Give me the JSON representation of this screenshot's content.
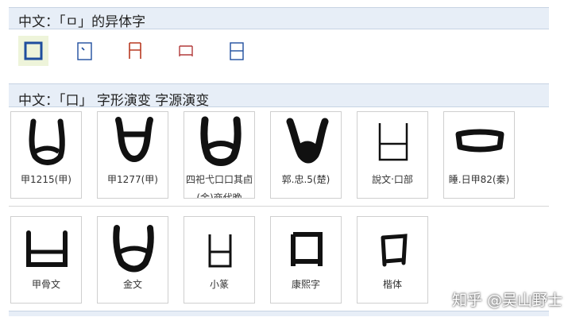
{
  "section1": {
    "title": "中文：「ㅁ」的异体字"
  },
  "variants": [
    {
      "icon": "kou-variant-1-icon",
      "color": "#1f4e9e",
      "selected": true
    },
    {
      "icon": "kou-variant-2-icon",
      "color": "#1f4e9e"
    },
    {
      "icon": "kou-variant-3-icon",
      "color": "#b83a22"
    },
    {
      "icon": "kou-variant-4-icon",
      "color": "#b23a3a"
    },
    {
      "icon": "kou-variant-5-icon",
      "color": "#1f4e9e"
    }
  ],
  "section2": {
    "title": "中文：「口」 字形演变 字源演变"
  },
  "row1": [
    {
      "label": "甲1215(甲)"
    },
    {
      "label": "甲1277(甲)"
    },
    {
      "label": "四祀弋口口其卣(金)商代晚"
    },
    {
      "label": "郭.忠.5(楚)"
    },
    {
      "label": "說文‧口部"
    },
    {
      "label": "睡.日甲82(秦)"
    }
  ],
  "row2": [
    {
      "label": "甲骨文"
    },
    {
      "label": "金文"
    },
    {
      "label": "小篆"
    },
    {
      "label": "康熙字"
    },
    {
      "label": "楷体"
    }
  ],
  "watermark": "知乎 @吴山野士",
  "colors": {
    "header_bg": "#e7eef7",
    "selected_bg": "#eef4da"
  }
}
